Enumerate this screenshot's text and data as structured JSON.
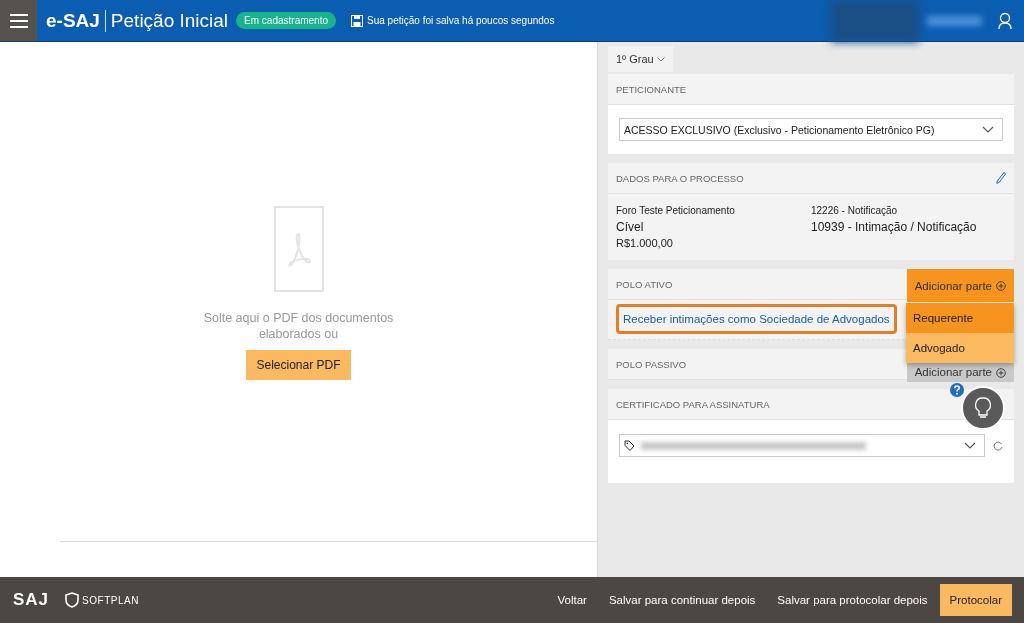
{
  "header": {
    "app_name": "e-SAJ",
    "page_title": "Petição Inicial",
    "status_badge": "Em cadastramento",
    "save_notice": "Sua petição foi salva há poucos segundos"
  },
  "upload": {
    "message": "Solte aqui o PDF dos documentos elaborados ou",
    "button": "Selecionar PDF"
  },
  "instance_tab": {
    "label": "1º Grau"
  },
  "sections": [
    {
      "kind": "select",
      "title": "PETICIONANTE",
      "value": "ACESSO EXCLUSIVO (Exclusivo - Peticionamento Eletrônico PG)"
    },
    {
      "kind": "details",
      "title": "DADOS PARA O PROCESSO",
      "columns": [
        [
          {
            "text": "Foro Teste Peticionamento",
            "kind": "sub"
          },
          {
            "text": "Cível",
            "kind": "main"
          },
          {
            "text": "R$1.000,00",
            "kind": "value"
          }
        ],
        [
          {
            "text": "12226 - Notificação",
            "kind": "sub"
          },
          {
            "text": "10939 - Intimação / Notificação",
            "kind": "main"
          }
        ]
      ]
    },
    {
      "kind": "party",
      "title": "POLO ATIVO",
      "button": "Adicionar parte",
      "active": true,
      "link": "Receber intimações como Sociedade de Advogados",
      "menu": [
        {
          "label": "Requerente",
          "selected": true
        },
        {
          "label": "Advogado",
          "selected": false
        }
      ]
    },
    {
      "kind": "party",
      "title": "POLO PASSIVO",
      "button": "Adicionar parte",
      "active": false
    },
    {
      "kind": "certificate",
      "title": "CERTIFICADO PARA ASSINATURA"
    }
  ],
  "footer": {
    "logos": [
      "SAJ",
      "SOFTPLAN"
    ],
    "actions": [
      {
        "label": "Voltar",
        "primary": false
      },
      {
        "label": "Salvar para continuar depois",
        "primary": false
      },
      {
        "label": "Salvar para protocolar depois",
        "primary": false
      },
      {
        "label": "Protocolar",
        "primary": true
      }
    ]
  }
}
